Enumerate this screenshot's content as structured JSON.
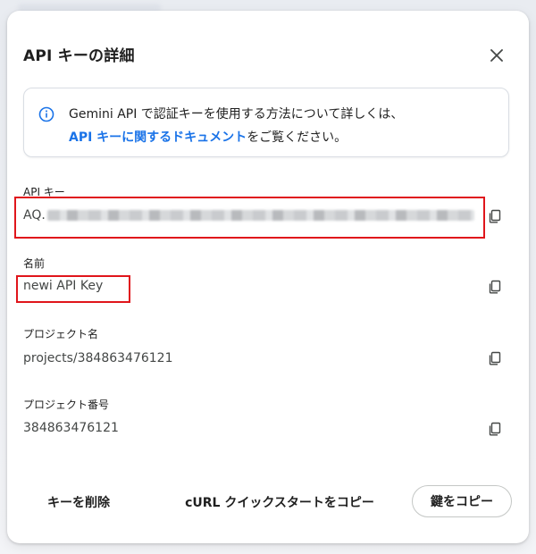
{
  "dialog": {
    "title": "API キーの詳細",
    "close_icon": "close-icon"
  },
  "info": {
    "icon": "info-icon",
    "line1": "Gemini API で認証キーを使用する方法について詳しくは、",
    "link": "API キーに関するドキュメント",
    "line2_suffix": "をご覧ください。"
  },
  "fields": {
    "api_key": {
      "label": "API キー",
      "value_prefix": "AQ.",
      "copy_icon": "copy-icon"
    },
    "name": {
      "label": "名前",
      "value": "newi API Key",
      "copy_icon": "copy-icon"
    },
    "project_name": {
      "label": "プロジェクト名",
      "value": "projects/384863476121",
      "copy_icon": "copy-icon"
    },
    "project_number": {
      "label": "プロジェクト番号",
      "value": "384863476121",
      "copy_icon": "copy-icon"
    }
  },
  "footer": {
    "delete_label": "キーを削除",
    "curl_label": "cURL クイックスタートをコピー",
    "copy_key_label": "鍵をコピー"
  },
  "colors": {
    "link": "#1a73e8",
    "highlight": "#e0151b",
    "text": "#1f1f1f",
    "muted": "#444746"
  }
}
